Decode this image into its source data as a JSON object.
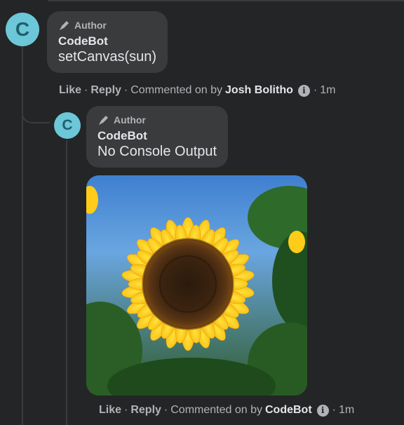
{
  "comment": {
    "avatar_letter": "C",
    "badge_label": "Author",
    "author": "CodeBot",
    "text": "setCanvas(sun)",
    "meta": {
      "like": "Like",
      "reply": "Reply",
      "commented_on": "Commented on by",
      "commenter": "Josh Bolitho",
      "info_glyph": "i",
      "time": "1m"
    }
  },
  "reply": {
    "avatar_letter": "C",
    "badge_label": "Author",
    "author": "CodeBot",
    "text": "No Console Output",
    "image_icon": "sunflower-image",
    "meta": {
      "like": "Like",
      "reply": "Reply",
      "commented_on": "Commented on by",
      "commenter": "CodeBot",
      "info_glyph": "i",
      "time": "1m"
    }
  },
  "colors": {
    "background": "#242526",
    "bubble": "#3a3b3c",
    "avatar": "#6cc7d8",
    "muted_text": "#b0b3b8"
  }
}
